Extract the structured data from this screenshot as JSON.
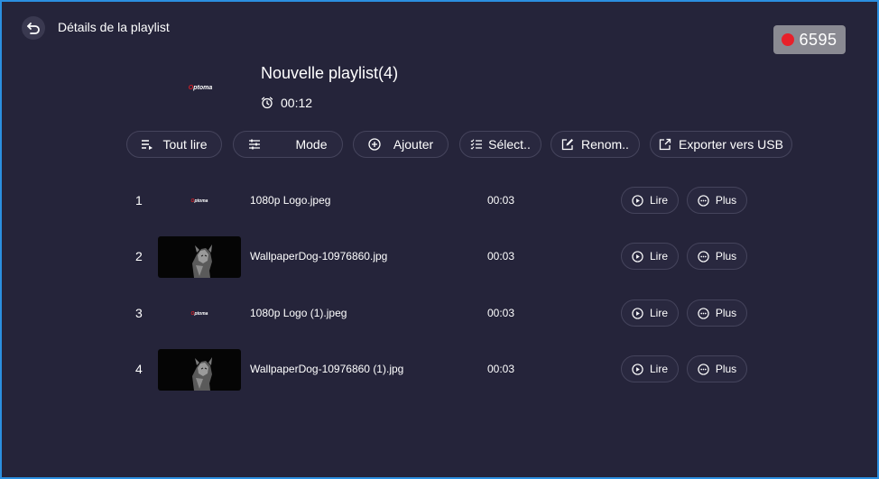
{
  "header": {
    "title": "Détails de la playlist",
    "back_icon": "back-arrow-icon",
    "record_count": "6595",
    "record_color": "#e8202a"
  },
  "playlist": {
    "name": "Nouvelle playlist(4)",
    "duration": "00:12",
    "cover_logo": "Optoma"
  },
  "toolbar": {
    "play_all": "Tout lire",
    "mode": "Mode",
    "add": "Ajouter",
    "select": "Sélect..",
    "rename": "Renom..",
    "export": "Exporter vers USB"
  },
  "items": [
    {
      "index": "1",
      "file": "1080p Logo.jpeg",
      "duration": "00:03",
      "thumb": "Optoma",
      "thumb_type": "logo"
    },
    {
      "index": "2",
      "file": "WallpaperDog-10976860.jpg",
      "duration": "00:03",
      "thumb_type": "photo"
    },
    {
      "index": "3",
      "file": "1080p Logo (1).jpeg",
      "duration": "00:03",
      "thumb": "Optoma",
      "thumb_type": "logo"
    },
    {
      "index": "4",
      "file": "WallpaperDog-10976860 (1).jpg",
      "duration": "00:03",
      "thumb_type": "photo"
    }
  ],
  "row_actions": {
    "play": "Lire",
    "more": "Plus"
  },
  "colors": {
    "background": "#25243a",
    "border": "#2b8fe0",
    "logo_accent": "#d61f26"
  }
}
